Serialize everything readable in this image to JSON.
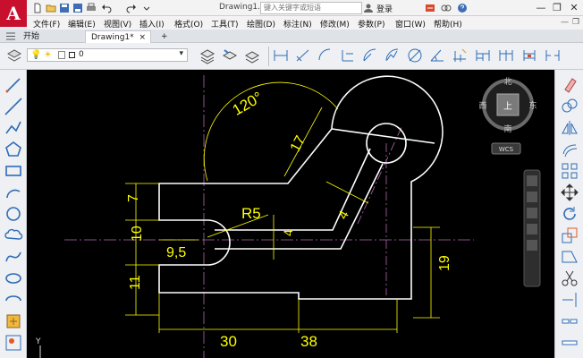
{
  "app": {
    "logo_text": "A"
  },
  "titlebar": {
    "title": "Drawing1...",
    "search_placeholder": "键入关键字或短语",
    "login_label": "登录",
    "minimize": "—",
    "restore": "❐",
    "close": "✕"
  },
  "menu": {
    "items": [
      "文件(F)",
      "编辑(E)",
      "视图(V)",
      "插入(I)",
      "格式(O)",
      "工具(T)",
      "绘图(D)",
      "标注(N)",
      "修改(M)",
      "参数(P)",
      "窗口(W)",
      "帮助(H)"
    ]
  },
  "tabs": {
    "start_label": "开始",
    "drawing_label": "Drawing1*",
    "close": "×",
    "add": "+"
  },
  "layer": {
    "current": "0"
  },
  "viewcube": {
    "north": "北",
    "south": "南",
    "west": "西",
    "east": "东",
    "top": "上",
    "wcs": "WCS"
  },
  "drawing": {
    "dims": {
      "angle": "120°",
      "d17": "17",
      "r5": "R5",
      "d4_top": "4",
      "d7": "7",
      "d10": "10",
      "d9_5": "9,5",
      "d4_mid": "4",
      "d11": "11",
      "d19": "19",
      "d30": "30",
      "d38": "38"
    }
  },
  "ucs": {
    "y_label": "Y"
  },
  "colors": {
    "canvas_bg": "#000000",
    "geometry": "#ffffff",
    "dimension": "#ffff00",
    "centerline": "#b06bb0",
    "logo": "#c8102e"
  }
}
